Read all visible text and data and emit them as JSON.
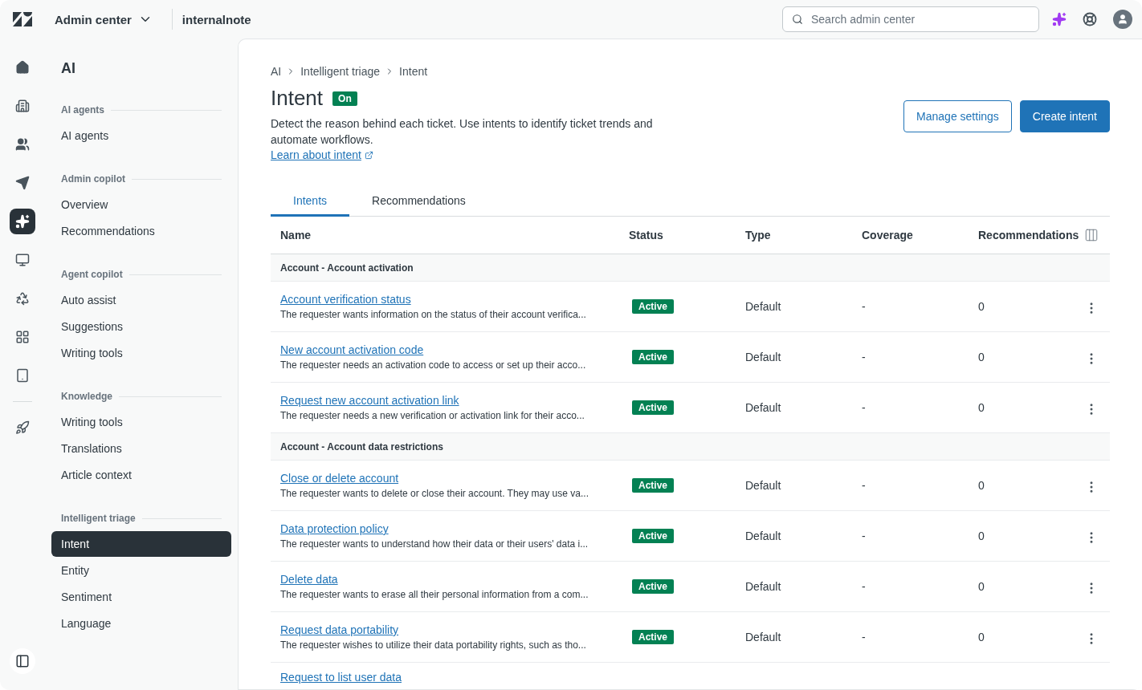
{
  "topbar": {
    "product": "Admin center",
    "account": "internalnote",
    "search": {
      "placeholder": "Search admin center"
    }
  },
  "rail": [
    {
      "selected": false
    },
    {
      "selected": false
    },
    {
      "selected": false
    },
    {
      "selected": false
    },
    {
      "selected": true
    },
    {
      "selected": false
    },
    {
      "selected": false
    },
    {
      "selected": false
    },
    {
      "selected": false
    },
    {
      "selected": false
    }
  ],
  "nav": {
    "title": "AI",
    "sections": [
      {
        "heading": "AI agents",
        "items": [
          {
            "label": "AI agents",
            "selected": false
          }
        ]
      },
      {
        "heading": "Admin copilot",
        "items": [
          {
            "label": "Overview",
            "selected": false
          },
          {
            "label": "Recommendations",
            "selected": false
          }
        ]
      },
      {
        "heading": "Agent copilot",
        "items": [
          {
            "label": "Auto assist",
            "selected": false
          },
          {
            "label": "Suggestions",
            "selected": false
          },
          {
            "label": "Writing tools",
            "selected": false
          }
        ]
      },
      {
        "heading": "Knowledge",
        "items": [
          {
            "label": "Writing tools",
            "selected": false
          },
          {
            "label": "Translations",
            "selected": false
          },
          {
            "label": "Article context",
            "selected": false
          }
        ]
      },
      {
        "heading": "Intelligent triage",
        "items": [
          {
            "label": "Intent",
            "selected": true
          },
          {
            "label": "Entity",
            "selected": false
          },
          {
            "label": "Sentiment",
            "selected": false
          },
          {
            "label": "Language",
            "selected": false
          }
        ]
      }
    ]
  },
  "breadcrumb": [
    "AI",
    "Intelligent triage",
    "Intent"
  ],
  "page": {
    "title": "Intent",
    "status_badge": "On",
    "description": "Detect the reason behind each ticket. Use intents to identify ticket trends and automate workflows.",
    "learn_link": "Learn about intent",
    "buttons": [
      {
        "label": "Manage settings",
        "kind": "secondary"
      },
      {
        "label": "Create intent",
        "kind": "primary"
      }
    ]
  },
  "tabs": [
    {
      "label": "Intents",
      "selected": true
    },
    {
      "label": "Recommendations",
      "selected": false
    }
  ],
  "table": {
    "columns": [
      "Name",
      "Status",
      "Type",
      "Coverage",
      "Recommendations"
    ],
    "rows": [
      {
        "kind": "group",
        "name": "Account - Account activation"
      },
      {
        "kind": "intent",
        "name": "Account verification status",
        "description": "The requester wants information on the status of their account verifica...",
        "status": "Active",
        "type": "Default",
        "coverage": "-",
        "recommendations": "0"
      },
      {
        "kind": "intent",
        "name": "New account activation code",
        "description": "The requester needs an activation code to access or set up their acco...",
        "status": "Active",
        "type": "Default",
        "coverage": "-",
        "recommendations": "0"
      },
      {
        "kind": "intent",
        "name": "Request new account activation link",
        "description": "The requester needs a new verification or activation link for their acco...",
        "status": "Active",
        "type": "Default",
        "coverage": "-",
        "recommendations": "0"
      },
      {
        "kind": "group",
        "name": "Account - Account data restrictions"
      },
      {
        "kind": "intent",
        "name": "Close or delete account",
        "description": "The requester wants to delete or close their account. They may use va...",
        "status": "Active",
        "type": "Default",
        "coverage": "-",
        "recommendations": "0"
      },
      {
        "kind": "intent",
        "name": "Data protection policy",
        "description": "The requester wants to understand how their data or their users' data i...",
        "status": "Active",
        "type": "Default",
        "coverage": "-",
        "recommendations": "0"
      },
      {
        "kind": "intent",
        "name": "Delete data",
        "description": "The requester wants to erase all their personal information from a com...",
        "status": "Active",
        "type": "Default",
        "coverage": "-",
        "recommendations": "0"
      },
      {
        "kind": "intent",
        "name": "Request data portability",
        "description": "The requester wishes to utilize their data portability rights, such as tho...",
        "status": "Active",
        "type": "Default",
        "coverage": "-",
        "recommendations": "0"
      },
      {
        "kind": "intent",
        "name": "Request to list user data"
      }
    ]
  }
}
